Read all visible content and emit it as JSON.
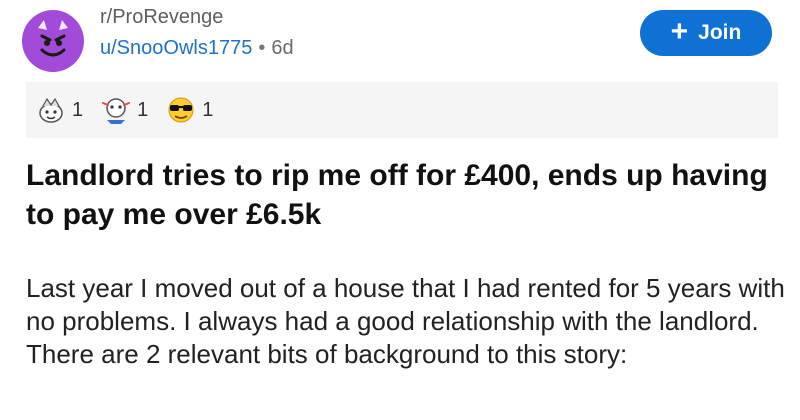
{
  "post": {
    "subreddit": "r/ProRevenge",
    "username": "u/SnooOwls1775",
    "separator": "•",
    "age": "6d",
    "join_label": "Join",
    "join_icon": "plus-icon",
    "awards": [
      {
        "icon": "silver-award-icon",
        "count": "1"
      },
      {
        "icon": "helpful-award-icon",
        "count": "1"
      },
      {
        "icon": "sunglasses-award-icon",
        "count": "1"
      }
    ],
    "title": "Landlord tries to rip me off for £400, ends up having to pay me over £6.5k",
    "body": "Last year I moved out of a house that I had rented for 5 years with no problems. I always had a good relationship with the landlord. There are 2 relevant bits of background to this story:"
  },
  "colors": {
    "accent": "#0f71d3",
    "avatar": "#a24bd8",
    "username": "#1f72c9",
    "awards_bg": "#f5f5f5"
  }
}
